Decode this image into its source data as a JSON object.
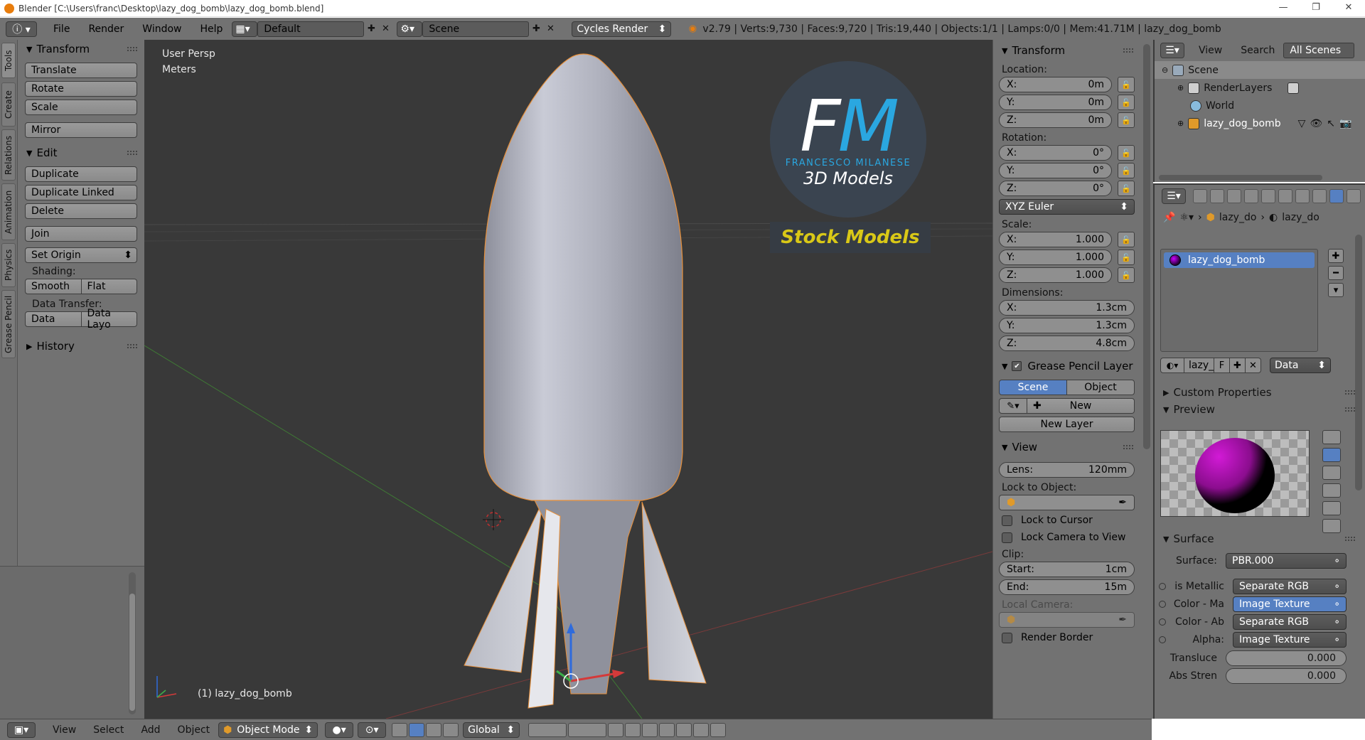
{
  "window": {
    "title": "Blender [C:\\Users\\franc\\Desktop\\lazy_dog_bomb\\lazy_dog_bomb.blend]",
    "minimize": "—",
    "maximize": "❐",
    "close": "✕"
  },
  "topbar": {
    "menus": [
      "File",
      "Render",
      "Window",
      "Help"
    ],
    "layout": "Default",
    "scene": "Scene",
    "engine": "Cycles Render",
    "stats": "v2.79 | Verts:9,730 | Faces:9,720 | Tris:19,440 | Objects:1/1 | Lamps:0/0 | Mem:41.71M | lazy_dog_bomb"
  },
  "toolshelf": {
    "vtabs": [
      "Tools",
      "Create",
      "Relations",
      "Animation",
      "Physics",
      "Grease Pencil"
    ],
    "transform_title": "Transform",
    "transform_buttons": [
      "Translate",
      "Rotate",
      "Scale"
    ],
    "mirror": "Mirror",
    "edit_title": "Edit",
    "edit_buttons": [
      "Duplicate",
      "Duplicate Linked",
      "Delete"
    ],
    "join": "Join",
    "set_origin": "Set Origin",
    "shading_label": "Shading:",
    "shading": [
      "Smooth",
      "Flat"
    ],
    "data_transfer_label": "Data Transfer:",
    "data_transfer": [
      "Data",
      "Data Layo"
    ],
    "history": "History"
  },
  "viewport": {
    "view_name": "User Persp",
    "units": "Meters",
    "object_label": "(1) lazy_dog_bomb",
    "watermark": {
      "initials_1": "F",
      "initials_2": "M",
      "name": "FRANCESCO MILANESE",
      "sub": "3D Models",
      "banner": "Stock Models"
    }
  },
  "npanel": {
    "transform_title": "Transform",
    "location_label": "Location:",
    "location": [
      {
        "axis": "X:",
        "value": "0m"
      },
      {
        "axis": "Y:",
        "value": "0m"
      },
      {
        "axis": "Z:",
        "value": "0m"
      }
    ],
    "rotation_label": "Rotation:",
    "rotation": [
      {
        "axis": "X:",
        "value": "0°"
      },
      {
        "axis": "Y:",
        "value": "0°"
      },
      {
        "axis": "Z:",
        "value": "0°"
      }
    ],
    "rotation_mode": "XYZ Euler",
    "scale_label": "Scale:",
    "scale": [
      {
        "axis": "X:",
        "value": "1.000"
      },
      {
        "axis": "Y:",
        "value": "1.000"
      },
      {
        "axis": "Z:",
        "value": "1.000"
      }
    ],
    "dimensions_label": "Dimensions:",
    "dimensions": [
      {
        "axis": "X:",
        "value": "1.3cm"
      },
      {
        "axis": "Y:",
        "value": "1.3cm"
      },
      {
        "axis": "Z:",
        "value": "4.8cm"
      }
    ],
    "gp_title": "Grease Pencil Layer",
    "gp_tabs": [
      "Scene",
      "Object"
    ],
    "gp_new": "New",
    "gp_new_layer": "New Layer",
    "view_title": "View",
    "lens_label": "Lens:",
    "lens_value": "120mm",
    "lock_to_object": "Lock to Object:",
    "lock_to_cursor": "Lock to Cursor",
    "lock_camera": "Lock Camera to View",
    "clip_label": "Clip:",
    "clip_start_label": "Start:",
    "clip_start": "1cm",
    "clip_end_label": "End:",
    "clip_end": "15m",
    "local_camera": "Local Camera:",
    "render_border": "Render Border"
  },
  "outliner": {
    "view": "View",
    "search": "Search",
    "filter": "All Scenes",
    "items": [
      "Scene",
      "RenderLayers",
      "World",
      "lazy_dog_bomb"
    ]
  },
  "properties": {
    "crumbs": [
      "lazy_do",
      "lazy_do"
    ],
    "material": "lazy_dog_bomb",
    "mat_slot": "lazy_",
    "mat_f": "F",
    "mat_link": "Data",
    "custom_props": "Custom Properties",
    "preview": "Preview",
    "surface_title": "Surface",
    "surface_rows": [
      {
        "label": "Surface:",
        "value": "PBR.000"
      },
      {
        "label": "is Metallic",
        "value": "Separate RGB"
      },
      {
        "label": "Color - Ma",
        "value": "Image Texture"
      },
      {
        "label": "Color - Ab",
        "value": "Separate RGB"
      },
      {
        "label": "Alpha:",
        "value": "Image Texture"
      },
      {
        "label": "Transluce",
        "value": "0.000"
      },
      {
        "label": "Abs Stren",
        "value": "0.000"
      }
    ]
  },
  "bottombar": {
    "menus": [
      "View",
      "Select",
      "Add",
      "Object"
    ],
    "mode": "Object Mode",
    "orientation": "Global"
  },
  "colors": {
    "accent": "#5680c2",
    "viewport_bg": "#393939",
    "panel_bg": "#727272",
    "bomb": "#b9bbc6",
    "outline": "#e8903a"
  }
}
